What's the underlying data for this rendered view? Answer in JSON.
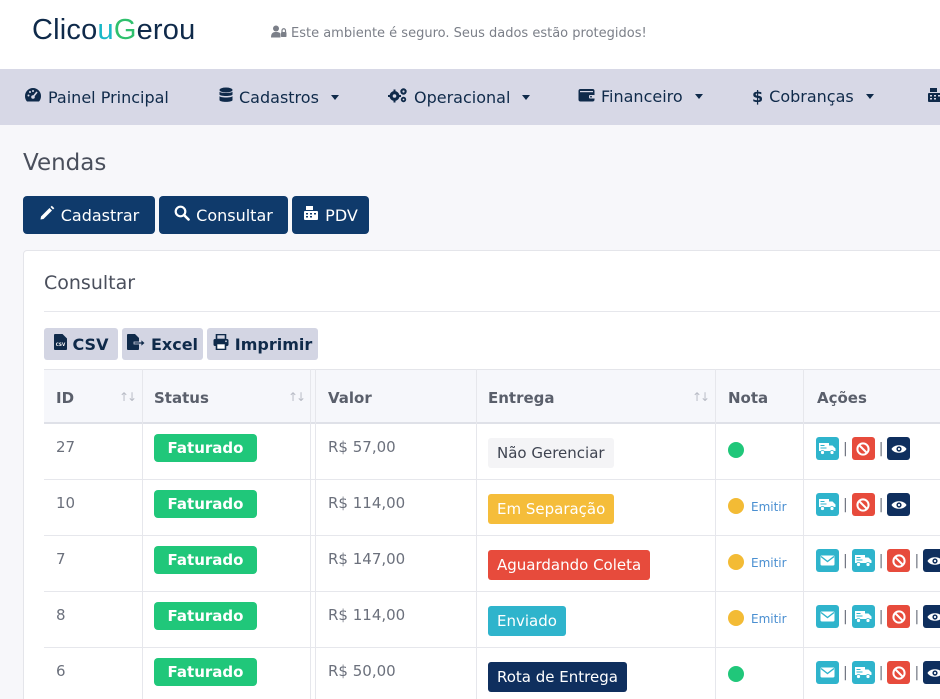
{
  "header": {
    "logo": {
      "part1": "Clico",
      "part2": "u",
      "part3": "G",
      "part4": "erou"
    },
    "secure_text": "Este ambiente é seguro. Seus dados estão protegidos!"
  },
  "nav": {
    "items": [
      {
        "label": "Painel Principal",
        "icon": "dashboard-icon"
      },
      {
        "label": "Cadastros",
        "icon": "database-icon"
      },
      {
        "label": "Operacional",
        "icon": "gears-icon"
      },
      {
        "label": "Financeiro",
        "icon": "wallet-icon"
      },
      {
        "label": "Cobranças",
        "icon": "dollar-icon"
      }
    ]
  },
  "page": {
    "title": "Vendas",
    "buttons": {
      "cadastrar": "Cadastrar",
      "consultar": "Consultar",
      "pdv": "PDV"
    }
  },
  "card": {
    "title": "Consultar",
    "export": {
      "csv": "CSV",
      "excel": "Excel",
      "imprimir": "Imprimir"
    }
  },
  "table": {
    "headers": [
      "ID",
      "Status",
      "Valor",
      "Entrega",
      "Nota",
      "Ações"
    ],
    "emitir_label": "Emitir",
    "rows": [
      {
        "id": "27",
        "status": "Faturado",
        "valor": "R$ 57,00",
        "entrega": "Não Gerenciar",
        "entrega_bg": "#f4f4f6",
        "entrega_fg": "#3f4451",
        "nota_color": "#20c77a",
        "emitir": false,
        "mail": false
      },
      {
        "id": "10",
        "status": "Faturado",
        "valor": "R$ 114,00",
        "entrega": "Em Separação",
        "entrega_bg": "#f5bd3a",
        "entrega_fg": "#ffffff",
        "nota_color": "#f3bb35",
        "emitir": true,
        "mail": false
      },
      {
        "id": "7",
        "status": "Faturado",
        "valor": "R$ 147,00",
        "entrega": "Aguardando Coleta",
        "entrega_bg": "#e74b3c",
        "entrega_fg": "#ffffff",
        "nota_color": "#f3bb35",
        "emitir": true,
        "mail": true
      },
      {
        "id": "8",
        "status": "Faturado",
        "valor": "R$ 114,00",
        "entrega": "Enviado",
        "entrega_bg": "#2fb4cc",
        "entrega_fg": "#ffffff",
        "nota_color": "#f3bb35",
        "emitir": true,
        "mail": true
      },
      {
        "id": "6",
        "status": "Faturado",
        "valor": "R$ 50,00",
        "entrega": "Rota de Entrega",
        "entrega_bg": "#0f2f5e",
        "entrega_fg": "#ffffff",
        "nota_color": "#20c77a",
        "emitir": false,
        "mail": true
      }
    ]
  },
  "colors": {
    "primary": "#0f3a6b",
    "nav_bg": "#d7d8e6",
    "success": "#20c77a",
    "action_cyan": "#2fb4cc",
    "action_red": "#e74b3c",
    "action_navy": "#0f2f5e"
  }
}
